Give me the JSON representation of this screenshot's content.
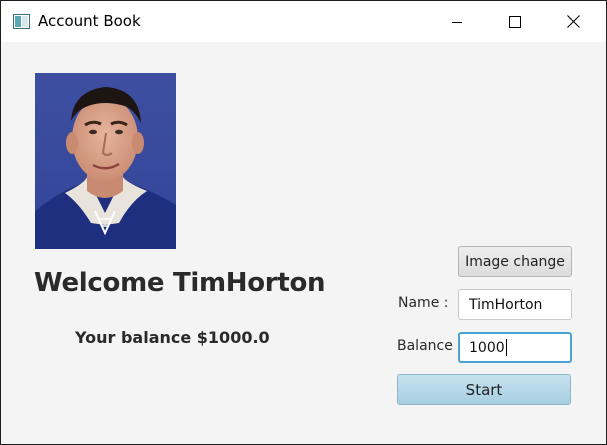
{
  "window": {
    "title": "Account Book"
  },
  "profile": {
    "welcome_text": "Welcome TimHorton",
    "balance_text": "Your balance $1000.0"
  },
  "form": {
    "image_change_label": "Image change",
    "name_label": "Name :",
    "name_value": "TimHorton",
    "balance_label": "Balance :",
    "balance_value": "1000",
    "start_label": "Start"
  },
  "colors": {
    "accent": "#4aa3d4",
    "start_button": "#b6d9ea"
  }
}
